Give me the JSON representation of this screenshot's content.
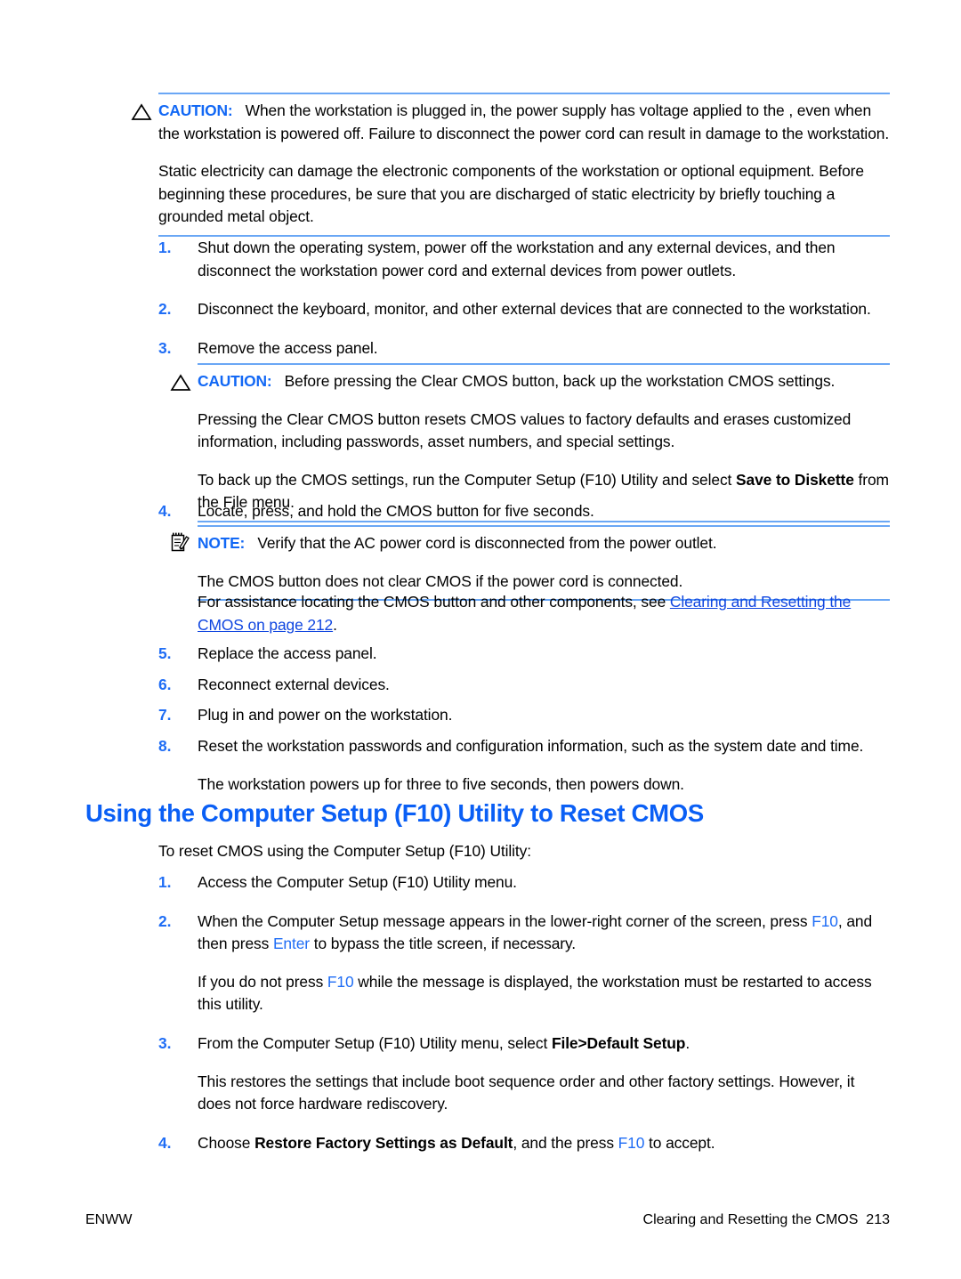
{
  "document": {
    "caution_label": "CAUTION:",
    "note_label": "NOTE:"
  },
  "caution_top": {
    "icon": "warning-triangle-icon",
    "label": "CAUTION:",
    "paragraphs": [
      "When the workstation is plugged in, the power supply has voltage applied to the , even when the workstation is powered off. Failure to disconnect the power cord can result in damage to the workstation.",
      "Static electricity can damage the electronic components of the workstation or optional equipment. Before beginning these procedures, be sure that you are discharged of static electricity by briefly touching a grounded metal object."
    ]
  },
  "steps_upper": [
    {
      "num": "1.",
      "text": "Shut down the operating system, power off the workstation and any external devices, and then disconnect the workstation power cord and external devices from power outlets."
    },
    {
      "num": "2.",
      "text": "Disconnect the keyboard, monitor, and other external devices that are connected to the workstation."
    },
    {
      "num": "3.",
      "text": "Remove the access panel."
    },
    {
      "num": "4.",
      "text": "Locate, press, and hold the CMOS button for five seconds."
    },
    {
      "num": "5.",
      "text": "Replace the access panel."
    },
    {
      "num": "6.",
      "text": "Reconnect external devices."
    },
    {
      "num": "7.",
      "text": "Plug in and power on the workstation."
    },
    {
      "num": "8.",
      "text": "Reset the workstation passwords and configuration information, such as the system date and time."
    }
  ],
  "caution_cmos": {
    "icon": "warning-triangle-icon",
    "label": "CAUTION:",
    "lead": "Before pressing the Clear CMOS button, back up the workstation CMOS settings.",
    "paragraph2": "Pressing the Clear CMOS button resets CMOS values to factory defaults and erases customized information, including passwords, asset numbers, and special settings.",
    "paragraph3_pre": "To back up the CMOS settings, run the Computer Setup (F10) Utility and select ",
    "paragraph3_bold": "Save to Diskette",
    "paragraph3_post": " from the File menu."
  },
  "note_cmos": {
    "icon": "note-pencil-icon",
    "label": "NOTE:",
    "lead": "Verify that the AC power cord is disconnected from the power outlet.",
    "paragraph2": "The CMOS button does not clear CMOS if the power cord is connected."
  },
  "xref_paragraph": {
    "pre": "For assistance locating the CMOS button and other components, see ",
    "link": "Clearing and Resetting the CMOS on page 212",
    "post": "."
  },
  "after_step8": "The workstation powers up for three to five seconds, then powers down.",
  "section": {
    "heading": "Using the Computer Setup (F10) Utility to Reset CMOS",
    "intro": "To reset CMOS using the Computer Setup (F10) Utility:"
  },
  "steps_lower": {
    "item1": {
      "num": "1.",
      "text": "Access the Computer Setup (F10) Utility menu."
    },
    "item2": {
      "num": "2.",
      "part1": "When the Computer Setup message appears in the lower-right corner of the screen, press ",
      "key1": "F10",
      "part2": ", and then press ",
      "key2": "Enter",
      "part3": " to bypass the title screen, if necessary."
    },
    "item2_note": {
      "part1": "If you do not press ",
      "key1": "F10",
      "part2": " while the message is displayed, the workstation must be restarted to access this utility."
    },
    "item3": {
      "num": "3.",
      "part1": "From the Computer Setup (F10) Utility menu, select ",
      "bold": "File>Default Setup",
      "part2": "."
    },
    "item3_note": "This restores the settings that include boot sequence order and other factory settings. However, it does not force hardware rediscovery.",
    "item4": {
      "num": "4.",
      "part1": "Choose ",
      "bold": "Restore Factory Settings as Default",
      "part2": ", and the press ",
      "key1": "F10",
      "part3": " to accept."
    }
  },
  "footer": {
    "left": "ENWW",
    "right": "Clearing and Resetting the CMOS  213"
  },
  "colors": {
    "accent_blue": "#1f6df5",
    "heading_blue": "#0a5ff5",
    "rule_blue": "#6aa7f5",
    "link_blue": "#1046e0",
    "text_black": "#000000"
  }
}
